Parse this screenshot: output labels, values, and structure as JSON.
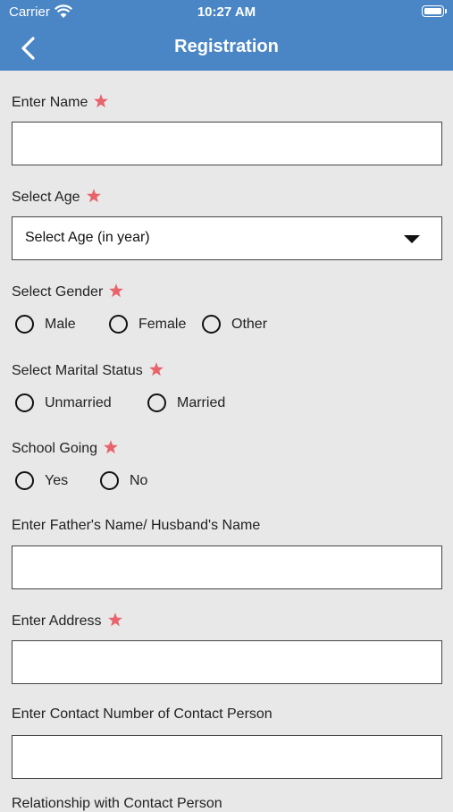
{
  "status_bar": {
    "carrier": "Carrier",
    "time": "10:27 AM"
  },
  "navbar": {
    "title": "Registration"
  },
  "colors": {
    "bar": "#4a86c5",
    "required_star": "#e8636b",
    "background": "#e9e8e9"
  },
  "form": {
    "name": {
      "label": "Enter Name",
      "value": ""
    },
    "age": {
      "label": "Select Age",
      "selected": "Select Age (in year)"
    },
    "gender": {
      "label": "Select Gender",
      "options": [
        "Male",
        "Female",
        "Other"
      ]
    },
    "marital": {
      "label": "Select Marital Status",
      "options": [
        "Unmarried",
        "Married"
      ]
    },
    "school": {
      "label": "School Going",
      "options": [
        "Yes",
        "No"
      ]
    },
    "father": {
      "label": "Enter Father's Name/ Husband's Name",
      "value": ""
    },
    "address": {
      "label": "Enter Address",
      "value": ""
    },
    "contact": {
      "label": "Enter Contact Number of Contact Person",
      "value": ""
    },
    "relationship": {
      "label": "Relationship with Contact Person"
    }
  }
}
